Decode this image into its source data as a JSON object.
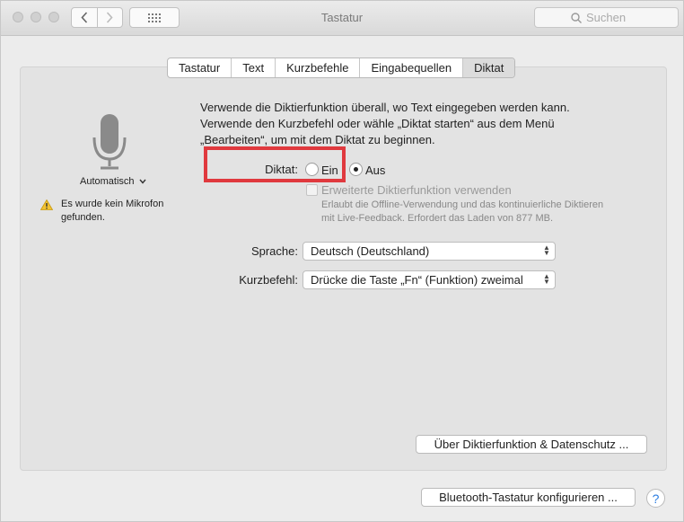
{
  "window": {
    "title": "Tastatur"
  },
  "search": {
    "placeholder": "Suchen"
  },
  "tabs": [
    {
      "label": "Tastatur"
    },
    {
      "label": "Text"
    },
    {
      "label": "Kurzbefehle"
    },
    {
      "label": "Eingabequellen"
    },
    {
      "label": "Diktat",
      "active": true
    }
  ],
  "mic": {
    "source_label": "Automatisch",
    "warning": "Es wurde kein Mikrofon gefunden."
  },
  "description": {
    "line1": "Verwende die Diktierfunktion überall, wo Text eingegeben werden kann.",
    "line2": "Verwende den Kurzbefehl oder wähle „Diktat starten“ aus dem Menü",
    "line3": "„Bearbeiten“, um mit dem Diktat zu beginnen."
  },
  "dictation": {
    "label": "Diktat:",
    "on_label": "Ein",
    "off_label": "Aus",
    "selected": "Aus"
  },
  "enhanced": {
    "label": "Erweiterte Diktierfunktion verwenden",
    "checked": false,
    "sub_line1": "Erlaubt die Offline-Verwendung und das kontinuierliche Diktieren",
    "sub_line2": "mit Live-Feedback. Erfordert das Laden von 877 MB."
  },
  "language": {
    "label": "Sprache:",
    "value": "Deutsch (Deutschland)"
  },
  "shortcut": {
    "label": "Kurzbefehl:",
    "value": "Drücke die Taste „Fn“ (Funktion) zweimal"
  },
  "buttons": {
    "about": "Über Diktierfunktion & Datenschutz ...",
    "bluetooth": "Bluetooth-Tastatur konfigurieren ...",
    "help": "?"
  },
  "colors": {
    "highlight": "#e0393e",
    "help_accent": "#2a7de1"
  }
}
